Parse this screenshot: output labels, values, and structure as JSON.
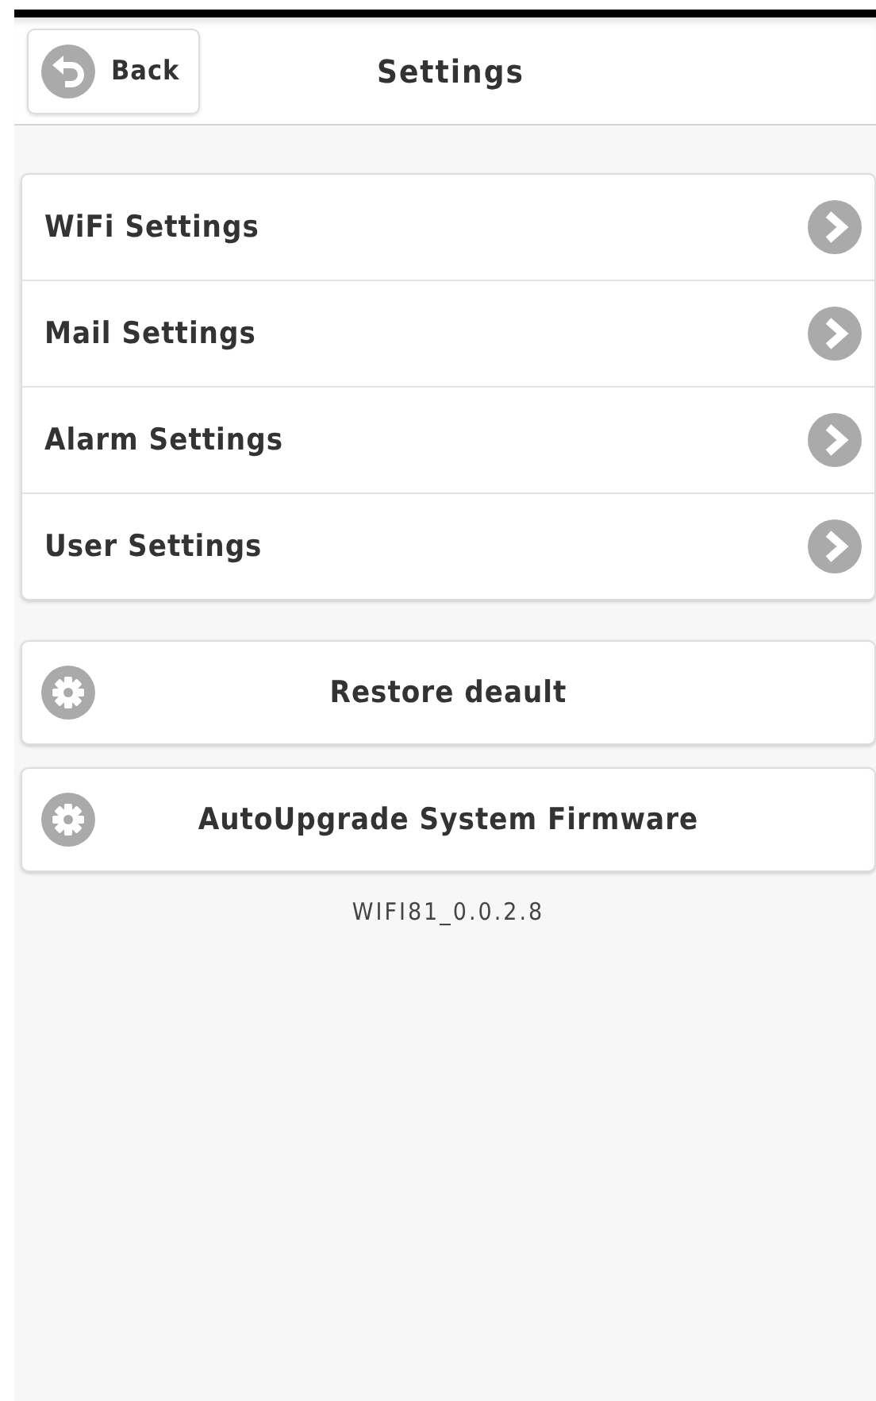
{
  "header": {
    "back_label": "Back",
    "title": "Settings"
  },
  "menu_items": [
    {
      "label": "WiFi Settings"
    },
    {
      "label": "Mail Settings"
    },
    {
      "label": "Alarm Settings"
    },
    {
      "label": "User Settings"
    }
  ],
  "actions": [
    {
      "label": "Restore deault"
    },
    {
      "label": "AutoUpgrade System Firmware"
    }
  ],
  "version": "WIFI81_0.0.2.8"
}
